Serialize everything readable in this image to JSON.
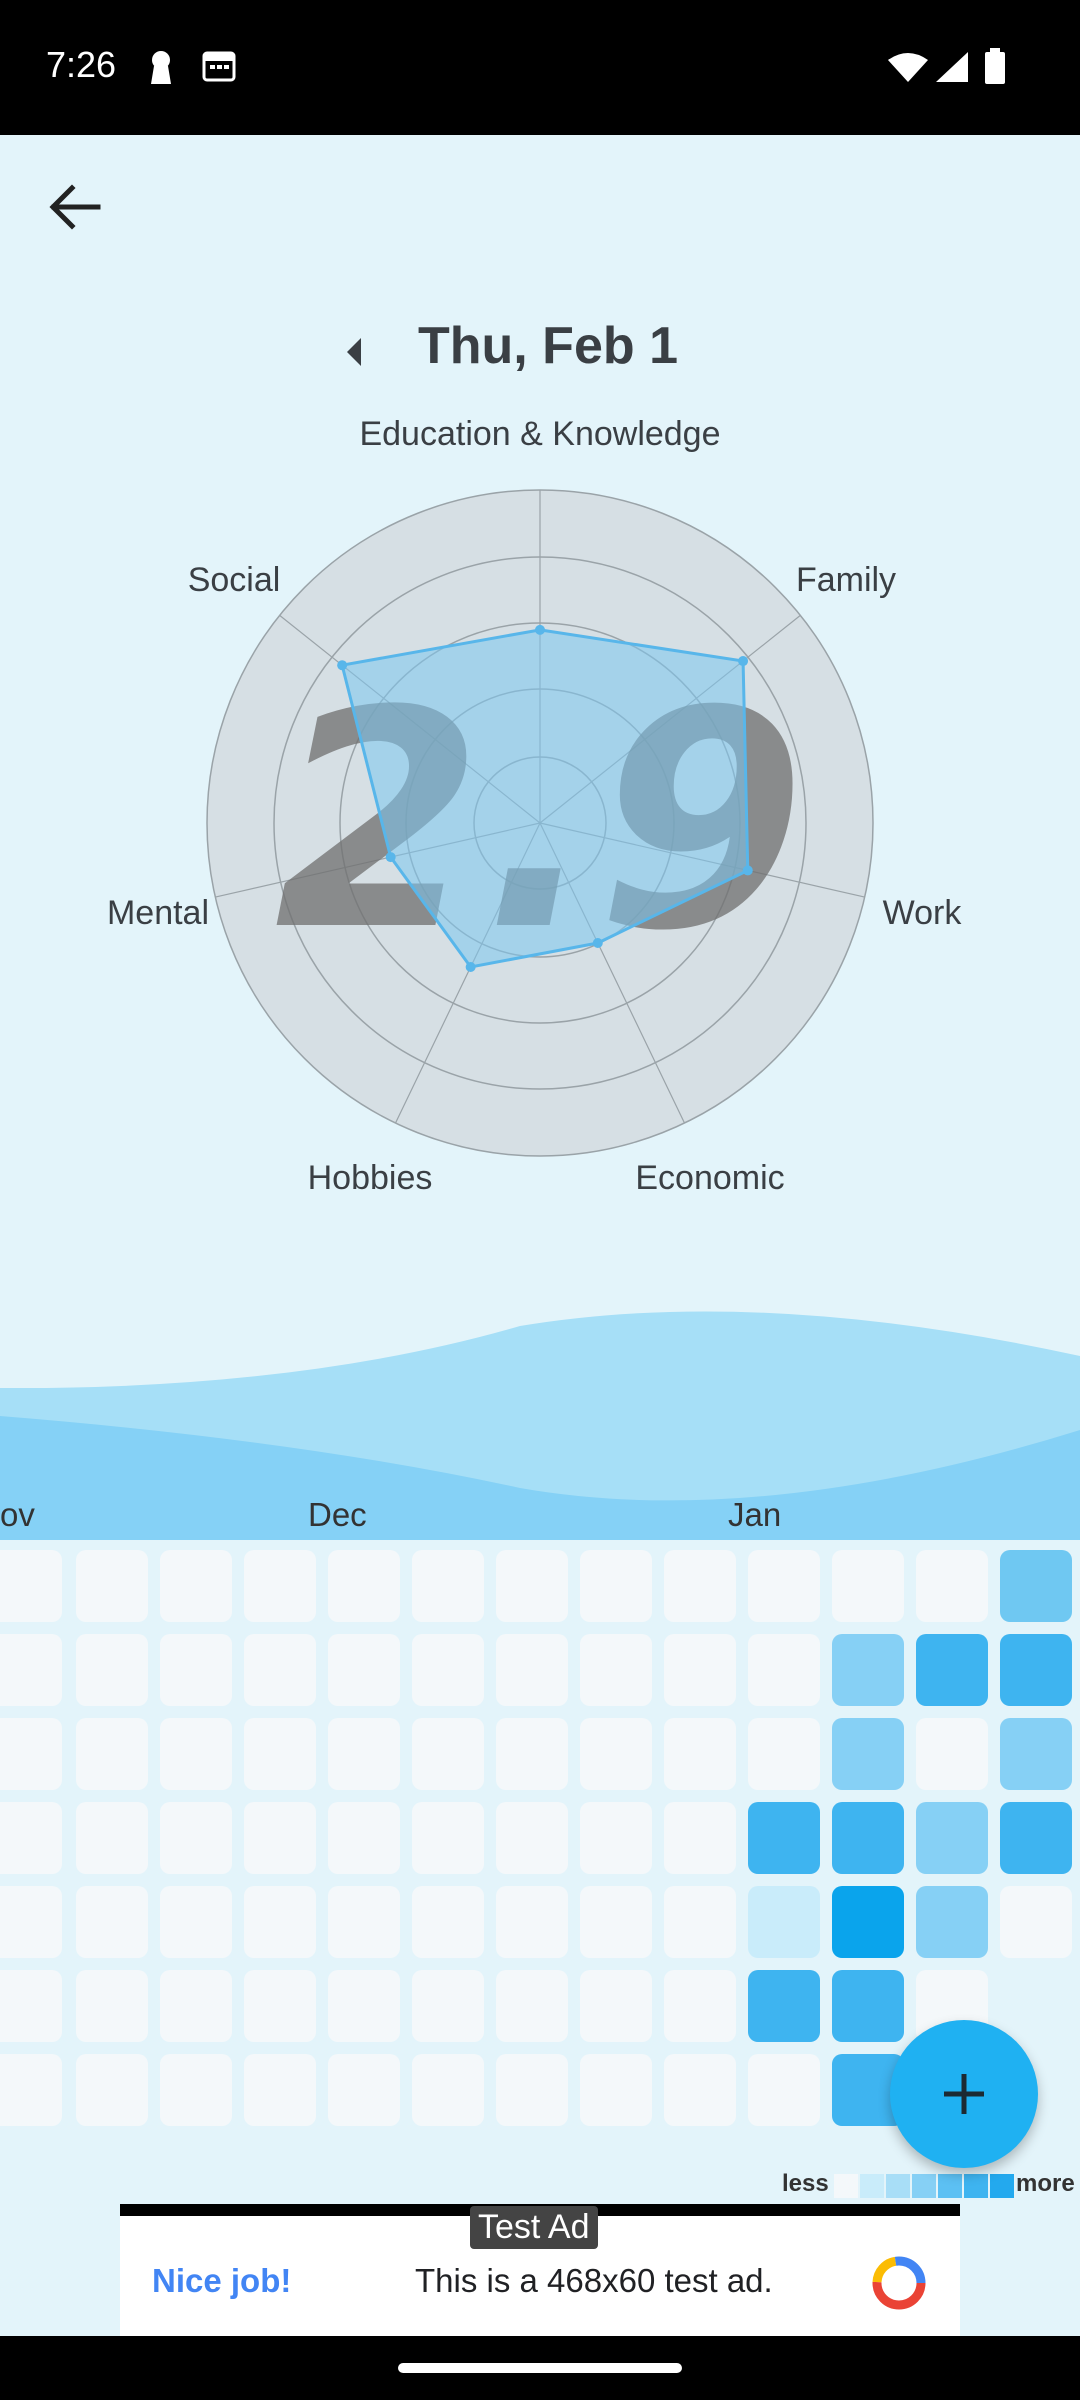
{
  "status": {
    "time": "7:26"
  },
  "header": {
    "date": "Thu, Feb 1"
  },
  "radar": {
    "score": "2.9",
    "labels": [
      "Education & Knowledge",
      "Family",
      "Work",
      "Economic",
      "Hobbies",
      "Mental",
      "Social"
    ],
    "values": [
      2.9,
      3.9,
      3.2,
      2.0,
      2.4,
      2.3,
      3.8
    ],
    "max": 5,
    "colors": {
      "fill": "#7cc7ee",
      "stroke": "#58b6ea",
      "score": "#6f6f6f"
    }
  },
  "heatmap": {
    "months": [
      "ov",
      "Dec",
      "Jan"
    ],
    "legend_less": "less",
    "legend_more": "more"
  },
  "fab": {
    "icon": "plus-icon"
  },
  "ad": {
    "tag": "Test Ad",
    "title": "Nice job!",
    "text": "This is a 468x60 test ad."
  }
}
